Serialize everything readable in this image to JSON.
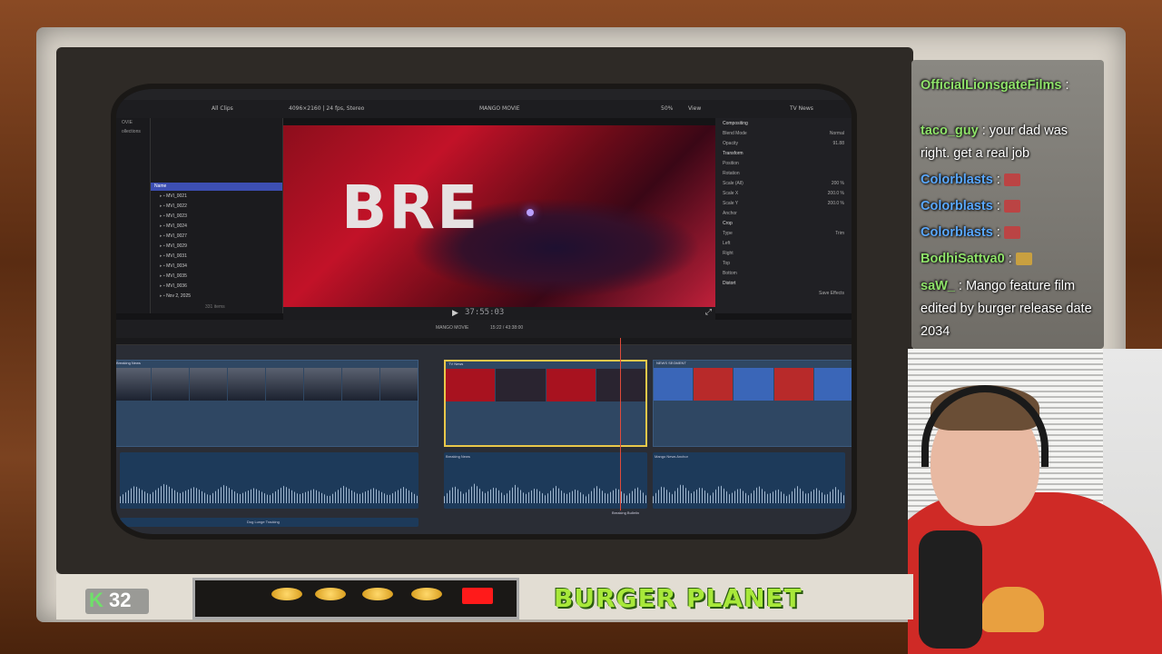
{
  "fcp": {
    "browser_filter": "All Clips",
    "format_info": "4096×2160 | 24 fps, Stereo",
    "project_title": "MANGO MOVIE",
    "zoom": "50%",
    "view_label": "View",
    "inspector_title": "TV News",
    "sidebar_items": [
      "OVIE",
      "ollections"
    ],
    "name_header": "Name",
    "clips": [
      "MVI_0021",
      "MVI_0022",
      "MVI_0023",
      "MVI_0024",
      "MVI_0027",
      "MVI_0029",
      "MVI_0031",
      "MVI_0034",
      "MVI_0035",
      "MVI_0036"
    ],
    "date_group": "Nov 2, 2025",
    "item_count": "331 items",
    "viewer_text": "BRE",
    "timecode": "37:55:03",
    "timeline_project": "MANGO MOVIE",
    "timeline_duration": "15:22 / 43:38:00",
    "inspector": {
      "compositing": "Compositing",
      "blend_mode_label": "Blend Mode",
      "blend_mode_value": "Normal",
      "opacity_label": "Opacity",
      "opacity_value": "91.88",
      "transform": "Transform",
      "position": "Position",
      "rotation": "Rotation",
      "scale_all": "Scale (All)",
      "scale_all_value": "200 %",
      "scale_x": "Scale X",
      "scale_x_value": "200.0 %",
      "scale_y": "Scale Y",
      "scale_y_value": "200.0 %",
      "anchor": "Anchor",
      "crop": "Crop",
      "type": "Type",
      "type_value": "Trim",
      "left": "Left",
      "right": "Right",
      "top": "Top",
      "bottom": "Bottom",
      "distort": "Distort",
      "save_effects": "Save Effects"
    },
    "timeline_clips": {
      "c1": "Breaking News",
      "c2": "TV News",
      "c3": "NEWS SEGMENT",
      "audio1": "Breaking News",
      "audio2": "Mango News Anchor",
      "audio3": "Breaking Bulletin",
      "audio4": "Dog Lunge Tracking"
    }
  },
  "chat": [
    {
      "name": "OfficialLionsgateFilms",
      "text": ":",
      "color": "green"
    },
    {
      "name": "taco_guy",
      "text": ": your dad was right. get a real job",
      "color": "green"
    },
    {
      "name": "Colorblasts",
      "text": ":",
      "color": "blue"
    },
    {
      "name": "Colorblasts",
      "text": ":",
      "color": "blue"
    },
    {
      "name": "Colorblasts",
      "text": ":",
      "color": "blue"
    },
    {
      "name": "BodhiSattva0",
      "text": ":",
      "color": "green"
    },
    {
      "name": "saW_",
      "text": ": Mango feature film edited by burger release date 2034",
      "color": "green"
    }
  ],
  "overlay": {
    "badge_letter": "K",
    "badge_count": "32",
    "brand": "BURGER PLANET"
  }
}
